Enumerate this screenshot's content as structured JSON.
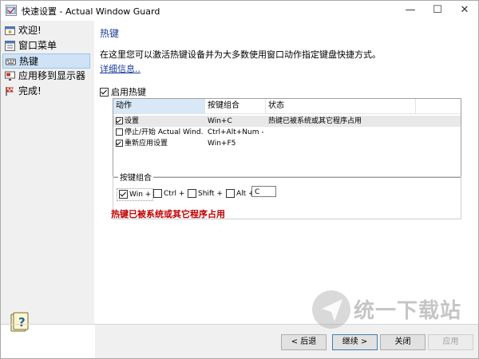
{
  "window": {
    "title": "快速设置 - Actual Window Guard"
  },
  "titlebar": {
    "minimize": "—",
    "maximize": "☐",
    "close": "✕"
  },
  "sidebar": {
    "items": [
      {
        "label": "欢迎!",
        "icon": "welcome-icon"
      },
      {
        "label": "窗口菜单",
        "icon": "window-menu-icon"
      },
      {
        "label": "热键",
        "icon": "keyboard-icon",
        "selected": true
      },
      {
        "label": "应用移到显示器",
        "icon": "monitor-icon"
      },
      {
        "label": "完成!",
        "icon": "finish-flag-icon"
      }
    ]
  },
  "content": {
    "heading": "热键",
    "intro": "在这里您可以激活热键设备并为大多数使用窗口动作指定键盘快捷方式。",
    "more_link": "详细信息..",
    "enable_label": "启用热键",
    "table": {
      "headers": [
        "动作",
        "按键组合",
        "状态"
      ],
      "rows": [
        {
          "checked": true,
          "action": "设置",
          "hotkey": "Win+C",
          "status": "热键已被系统或其它程序占用"
        },
        {
          "checked": false,
          "action": "停止/开始 Actual Wind...",
          "hotkey": "Ctrl+Alt+Num -",
          "status": ""
        },
        {
          "checked": true,
          "action": "重新应用设置",
          "hotkey": "Win+F5",
          "status": ""
        }
      ]
    },
    "hotkey_group": {
      "title": "按键组合",
      "modifiers": [
        {
          "label": "Win +",
          "checked": true
        },
        {
          "label": "Ctrl +",
          "checked": false
        },
        {
          "label": "Shift +",
          "checked": false
        },
        {
          "label": "Alt +",
          "checked": false
        }
      ],
      "key_value": "C"
    },
    "error_message": "热键已被系统或其它程序占用"
  },
  "footer": {
    "back": "< 后退",
    "next": "继续 >",
    "close": "关闭",
    "apply": "应用"
  },
  "watermark": {
    "text": "统一下载站"
  },
  "colors": {
    "accent": "#1a3d9c",
    "error": "#c00000",
    "selected_bg": "#cfe2f6"
  }
}
